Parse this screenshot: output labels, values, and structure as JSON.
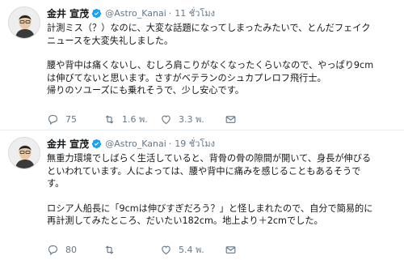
{
  "tweets": [
    {
      "name": "金井 宣茂",
      "handle": "@Astro_Kanai",
      "separator": "·",
      "time": "11 ชั่วโมง",
      "lines": [
        "計測ミス（？）なのに、大変な話題になってしまったみたいで、とんだフェイク",
        "ニュースを大変失礼しました。",
        "",
        "腰や背中は痛くないし、むしろ肩こりがなくなったくらいなので、やっぱり9cm",
        "は伸びてないと思います。さすがベテランのシュカプレロフ飛行士。",
        "帰りのソユーズにも乗れそうで、少し安心です。"
      ],
      "replies": "75",
      "retweets": "1.6 พ.",
      "likes": "3.3 พ."
    },
    {
      "name": "金井 宣茂",
      "handle": "@Astro_Kanai",
      "separator": "·",
      "time": "19 ชั่วโมง",
      "lines": [
        "無重力環境でしばらく生活していると、背骨の骨の隙間が開いて、身長が伸びる",
        "といわれています。人によっては、腰や背中に痛みを感じることもあるそうで",
        "す。",
        "",
        "ロシア人船長に「9cmは伸びすぎだろう？」と怪しまれたので、自分で簡易的に",
        "再計測してみたところ、だいたい182cm。地上より＋2cmでした。"
      ],
      "replies": "80",
      "retweets": "",
      "likes": "5.4 พ."
    }
  ],
  "colors": {
    "text": "#14171a",
    "muted": "#657786",
    "verified": "#1da1f2",
    "divider": "#e6ecf0"
  },
  "icons": {
    "verified": "verified-badge-icon",
    "reply": "reply-icon",
    "retweet": "retweet-icon",
    "like": "heart-icon",
    "message": "envelope-icon"
  }
}
